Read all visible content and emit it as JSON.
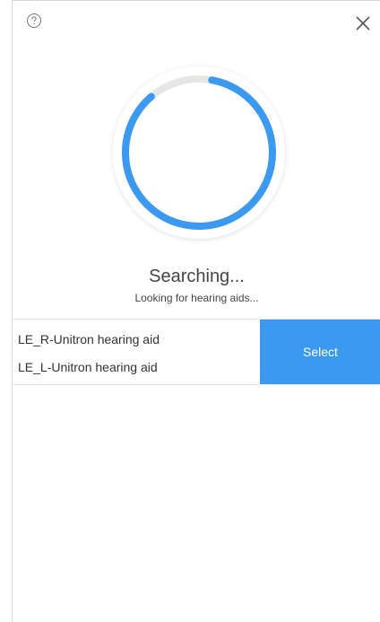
{
  "header": {
    "help_icon": "question-circle-icon",
    "close_icon": "close-x-icon"
  },
  "search": {
    "progress_fraction": 0.86,
    "spinner_color": "#3b99f0",
    "track_color": "#e6e6e6",
    "title": "Searching...",
    "subtitle": "Looking for hearing aids..."
  },
  "devices": {
    "items": [
      {
        "label": "LE_R-Unitron hearing aid"
      },
      {
        "label": "LE_L-Unitron hearing aid"
      }
    ],
    "select_label": "Select",
    "accent_color": "#3b99f0"
  }
}
